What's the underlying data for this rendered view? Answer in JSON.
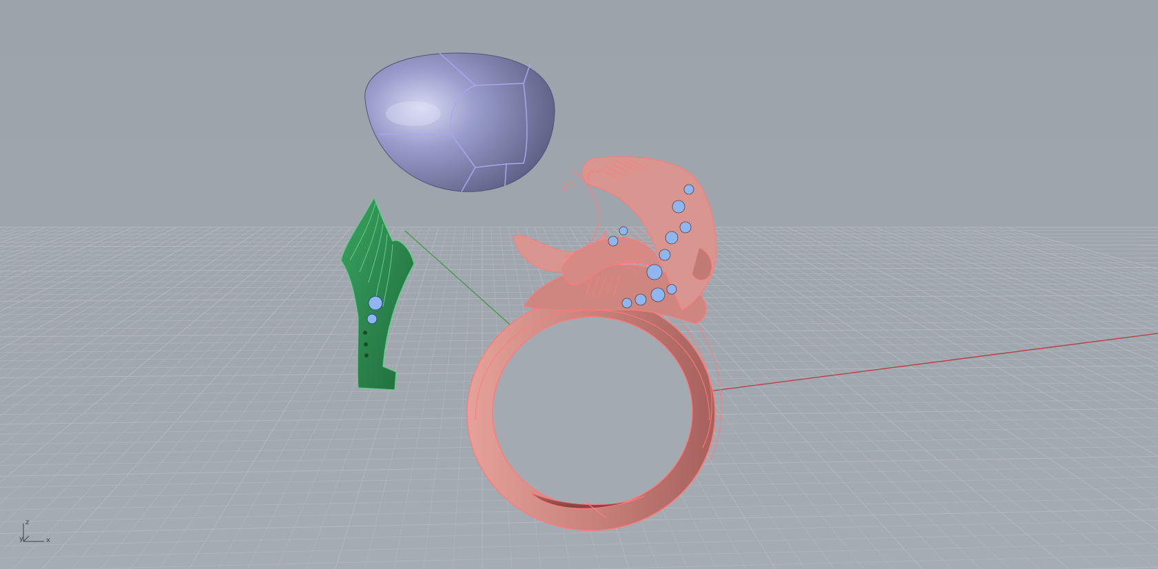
{
  "viewport": {
    "background_color": "#9ea5ac",
    "grid_color": "#b3b9bf",
    "x_axis_color": "#b5393a",
    "y_axis_color": "#3f9a3f"
  },
  "objects": [
    {
      "id": "gemstone",
      "kind": "cabochon-stone",
      "color": "#7c7fae",
      "edge_color": "#a9a7ec"
    },
    {
      "id": "green-part",
      "kind": "ring-side-piece",
      "color": "#2e8a4e",
      "edge_color": "#5fd08a"
    },
    {
      "id": "ring",
      "kind": "ring-body",
      "color": "#d68a85",
      "edge_color": "#ff7b7b"
    },
    {
      "id": "accent-stones",
      "kind": "pave-stones",
      "color": "#8fb6ef"
    }
  ],
  "axis_widget": {
    "z": "z",
    "x": "x",
    "y": "y"
  }
}
